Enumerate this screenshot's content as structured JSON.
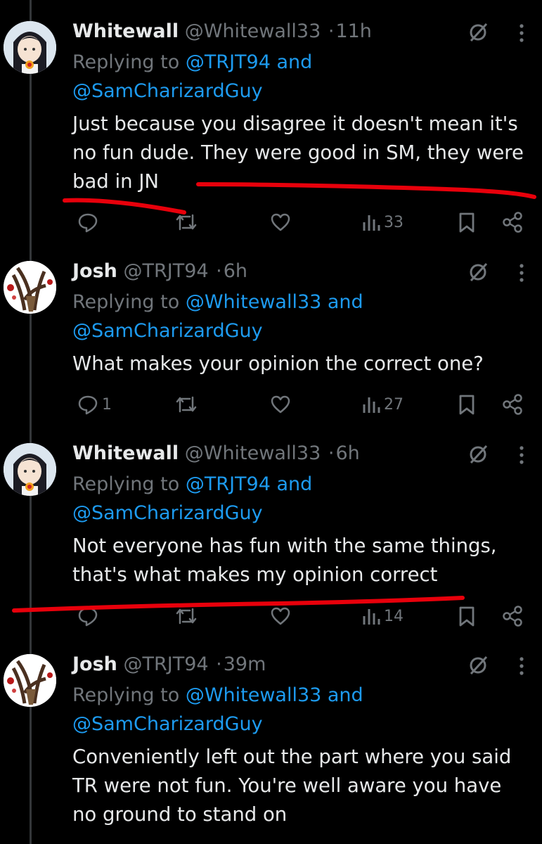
{
  "tweets": [
    {
      "name": "Whitewall",
      "handle": "@Whitewall33",
      "dot": "·",
      "time": "11h",
      "replying_prefix": "Replying to",
      "replying_link1": "@TRJT94 and",
      "replying_link2": "@SamCharizardGuy",
      "text_lines": [
        "Just because you disagree it doesn't mean it's",
        "no fun dude. They were good in SM, they were",
        "bad in JN"
      ],
      "reply_count": "",
      "views": "33"
    },
    {
      "name": "Josh",
      "handle": "@TRJT94",
      "dot": "·",
      "time": "6h",
      "replying_prefix": "Replying to",
      "replying_link1": "@Whitewall33 and",
      "replying_link2": "@SamCharizardGuy",
      "text_lines": [
        "What makes your opinion the correct one?"
      ],
      "reply_count": "1",
      "views": "27"
    },
    {
      "name": "Whitewall",
      "handle": "@Whitewall33",
      "dot": "·",
      "time": "6h",
      "replying_prefix": "Replying to",
      "replying_link1": "@TRJT94 and",
      "replying_link2": "@SamCharizardGuy",
      "text_lines": [
        "Not everyone has fun with the same things,",
        "that's what makes my opinion correct"
      ],
      "reply_count": "",
      "views": "14"
    },
    {
      "name": "Josh",
      "handle": "@TRJT94",
      "dot": "·",
      "time": "39m",
      "replying_prefix": "Replying to",
      "replying_link1": "@Whitewall33 and",
      "replying_link2": "@SamCharizardGuy",
      "text_lines": [
        "Conveniently left out the part where you said",
        "TR were not fun. You're well aware you have",
        "no ground to stand on"
      ]
    }
  ],
  "colors": {
    "background": "#000000",
    "text": "#e7e9ea",
    "muted": "#71767b",
    "link": "#1d9bf0",
    "annotation": "#e8000b"
  },
  "icons": [
    "grok-icon",
    "more-icon",
    "reply-icon",
    "retweet-icon",
    "like-icon",
    "views-icon",
    "bookmark-icon",
    "share-icon"
  ]
}
